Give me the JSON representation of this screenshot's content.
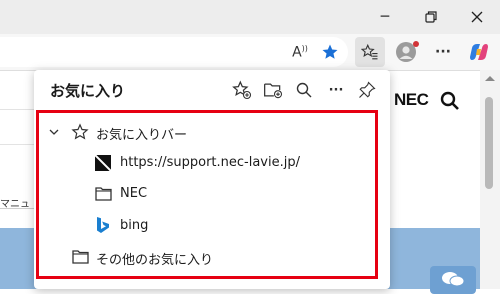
{
  "window": {
    "controls": {
      "minimize": "─",
      "restore": "⧉",
      "close": "✕"
    }
  },
  "toolbar": {
    "read_aloud_label": "A",
    "icons": [
      "read-aloud-icon",
      "favorite-star-icon",
      "favorites-icon",
      "profile-icon",
      "more-icon",
      "copilot-icon"
    ],
    "more_label": "···",
    "accent_color": "#1a6fd6",
    "notification_color": "#d13438"
  },
  "favorites_panel": {
    "title": "お気に入り",
    "header_icons": [
      "add-favorite-icon",
      "add-folder-icon",
      "search-icon",
      "more-options-icon",
      "pin-icon"
    ],
    "more_label": "···",
    "bar_folder": {
      "label": "お気に入りバー",
      "expanded": true
    },
    "items": [
      {
        "label": "https://support.nec-lavie.jp/",
        "icon": "site-favicon"
      },
      {
        "label": "NEC",
        "icon": "folder-icon"
      },
      {
        "label": "bing",
        "icon": "bing-icon"
      }
    ],
    "other_folder": {
      "label": "その他のお気に入り"
    },
    "highlight_color": "#e60012"
  },
  "page": {
    "brand_text": "NEC",
    "snippet_text": "マニュ",
    "banner_color": "#8fb6dc"
  }
}
